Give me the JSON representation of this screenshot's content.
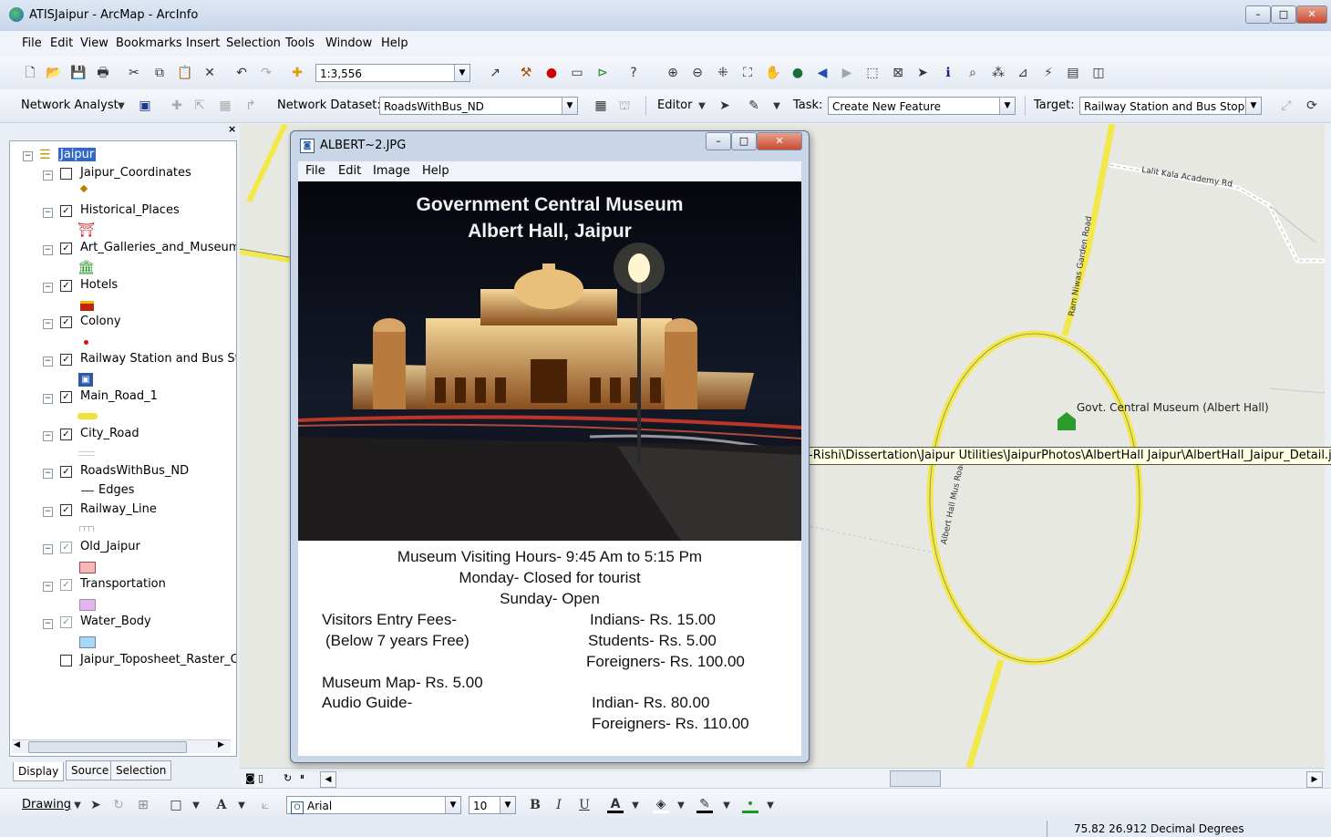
{
  "window": {
    "title": "ATISJaipur - ArcMap - ArcInfo",
    "buttons": [
      "–",
      "□",
      "✕"
    ]
  },
  "menubar": [
    "File",
    "Edit",
    "View",
    "Bookmarks",
    "Insert",
    "Selection",
    "Tools",
    "Window",
    "Help"
  ],
  "standard_toolbar": {
    "scale": "1:3,556"
  },
  "network_toolbar": {
    "network_analyst_label": "Network Analyst",
    "dataset_label": "Network Dataset:",
    "dataset_value": "RoadsWithBus_ND",
    "editor_label": "Editor",
    "task_label": "Task:",
    "task_value": "Create New Feature",
    "target_label": "Target:",
    "target_value": "Railway Station and Bus Stop"
  },
  "toc": {
    "root": "Jaipur",
    "layers": [
      {
        "name": "Jaipur_Coordinates",
        "checked": false
      },
      {
        "name": "Historical_Places",
        "checked": true
      },
      {
        "name": "Art_Galleries_and_Museum",
        "checked": true
      },
      {
        "name": "Hotels",
        "checked": true
      },
      {
        "name": "Colony",
        "checked": true
      },
      {
        "name": "Railway Station and Bus Stc",
        "checked": true
      },
      {
        "name": "Main_Road_1",
        "checked": true
      },
      {
        "name": "City_Road",
        "checked": true
      },
      {
        "name": "RoadsWithBus_ND",
        "checked": true,
        "sub": "Edges"
      },
      {
        "name": "Railway_Line",
        "checked": true
      },
      {
        "name": "Old_Jaipur",
        "checked": true
      },
      {
        "name": "Transportation",
        "checked": true
      },
      {
        "name": "Water_Body",
        "checked": true
      },
      {
        "name": "Jaipur_Toposheet_Raster_C",
        "checked": false
      }
    ],
    "tabs": [
      "Display",
      "Source",
      "Selection"
    ]
  },
  "map": {
    "labels": {
      "lalit": "Lalit Kala Academy Rd",
      "ramniwas": "Ram Niwas Garden Road",
      "museum": "Govt. Central Museum (Albert Hall)",
      "albert_road": "Albert Hall Mus Road"
    },
    "hyperlink_path": "-Rishi\\Dissertation\\Jaipur Utilities\\JaipurPhotos\\AlbertHall Jaipur\\AlbertHall_Jaipur_Detail.jpg"
  },
  "viewer": {
    "title": "ALBERT~2.JPG",
    "menu": [
      "File",
      "Edit",
      "Image",
      "Help"
    ],
    "photo_title_1": "Government Central Museum",
    "photo_title_2": "Albert Hall, Jaipur",
    "info": {
      "hours": "Museum Visiting Hours- 9:45 Am to 5:15 Pm",
      "monday": "Monday- Closed for tourist",
      "sunday": "Sunday- Open",
      "entry_fees": "Visitors Entry Fees-",
      "below7": "(Below 7 years Free)",
      "indians": "Indians- Rs. 15.00",
      "students": "Students- Rs. 5.00",
      "foreigners": "Foreigners- Rs. 100.00",
      "map": "Museum Map- Rs. 5.00",
      "audio": "Audio Guide-",
      "audio_indians": "Indian- Rs. 80.00",
      "audio_foreigners": "Foreigners- Rs. 110.00"
    }
  },
  "drawing_toolbar": {
    "drawing_label": "Drawing",
    "font": "Arial",
    "size": "10",
    "bold": "B",
    "italic": "I",
    "underline": "U"
  },
  "status": {
    "coords": "75.82  26.912 Decimal Degrees"
  }
}
